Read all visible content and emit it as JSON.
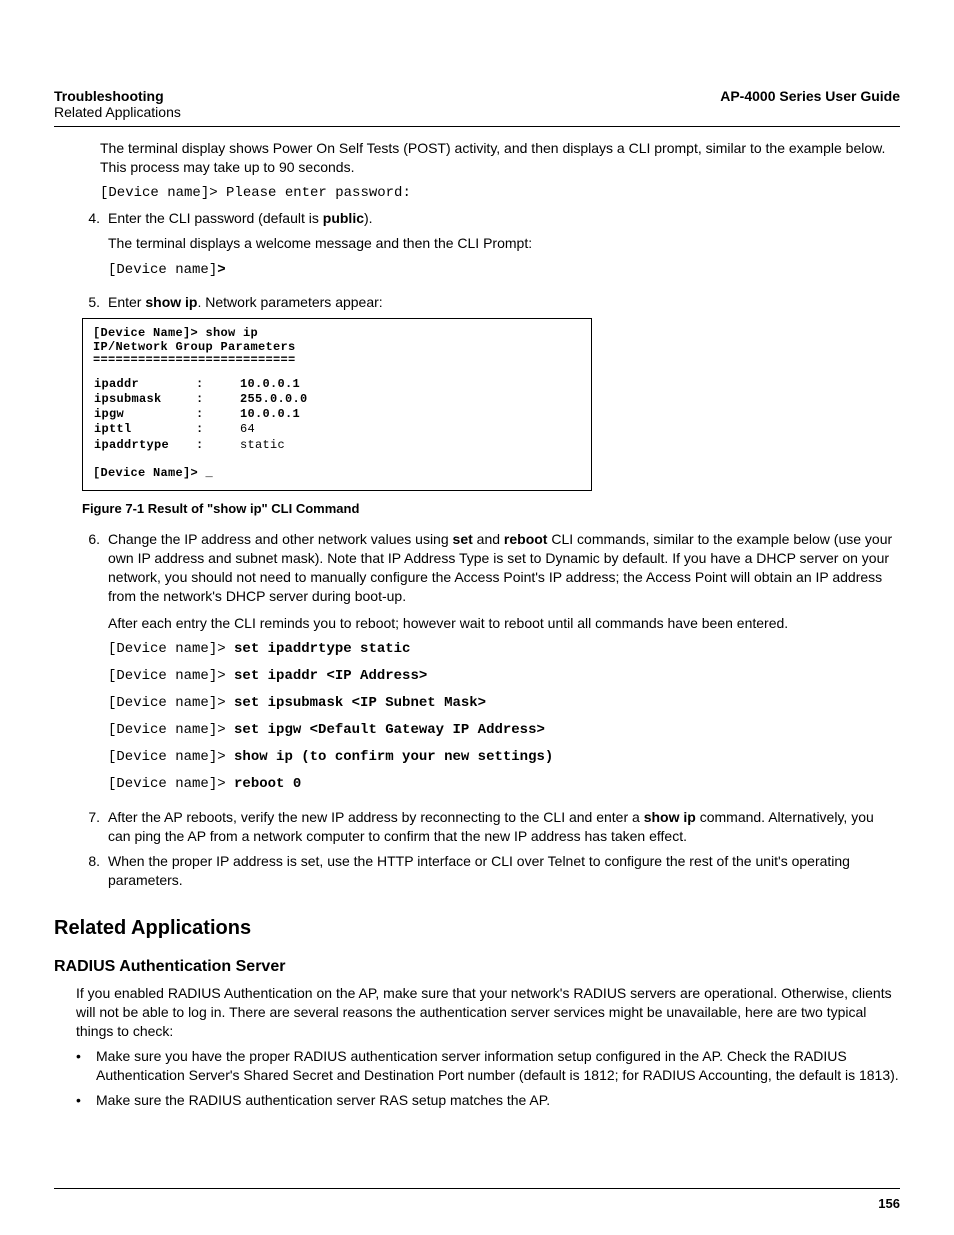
{
  "header": {
    "left1": "Troubleshooting",
    "left2": "Related Applications",
    "right": "AP-4000 Series User Guide"
  },
  "intro": "The terminal display shows Power On Self Tests (POST) activity, and then displays a CLI prompt, similar to the example below. This process may take up to 90 seconds.",
  "mono1": "[Device name]> Please enter password:",
  "step4": {
    "num": "4.",
    "line_a": "Enter the CLI password (default is ",
    "bold_a": "public",
    "line_b": ").",
    "line2": "The terminal displays a welcome message and then the CLI Prompt:",
    "mono_prefix": "[Device name]",
    "mono_suffix": ">"
  },
  "step5": {
    "num": "5.",
    "txt_a": "Enter ",
    "bold": "show ip",
    "txt_b": ". Network parameters appear:"
  },
  "figure": {
    "l1": "[Device Name]> show ip",
    "l2": "IP/Network Group Parameters",
    "dash": "===========================",
    "r1a": "ipaddr",
    "r1b": ":",
    "r1c": "10.0.0.1",
    "r2a": "ipsubmask",
    "r2b": ":",
    "r2c": "255.0.0.0",
    "r3a": "ipgw",
    "r3b": ":",
    "r3c": "10.0.0.1",
    "r4a": "ipttl",
    "r4b": ":",
    "r4c": "64",
    "r5a": "ipaddrtype",
    "r5b": ":",
    "r5c": "static",
    "last": "[Device Name]> _"
  },
  "caption": "Figure 7-1 Result of \"show ip\" CLI Command",
  "step6": {
    "num": "6.",
    "a": "Change the IP address and other network values using ",
    "b1": "set",
    "mid": " and ",
    "b2": "reboot",
    "c": " CLI commands, similar to the example below (use your own IP address and subnet mask). Note that IP Address Type is set to Dynamic by default. If you have a DHCP server on your network, you should not need to manually configure the Access Point's IP address; the Access Point will obtain an IP address from the network's DHCP server during boot-up.",
    "after": "After each entry the CLI reminds you to reboot; however wait to reboot until all commands have been entered.",
    "cmds": {
      "p": "[Device name]> ",
      "c1": "set ipaddrtype static",
      "c2": "set ipaddr <IP Address>",
      "c3": "set ipsubmask <IP Subnet Mask>",
      "c4": "set ipgw <Default Gateway IP Address>",
      "c5": "show ip (to confirm your new settings)",
      "c6": "reboot 0"
    }
  },
  "step7": {
    "num": "7.",
    "a": "After the AP reboots, verify the new IP address by reconnecting to the CLI and enter a ",
    "b": "show ip",
    "c": " command. Alternatively, you can ping the AP from a network computer to confirm that the new IP address has taken effect."
  },
  "step8": {
    "num": "8.",
    "txt": "When the proper IP address is set, use the HTTP interface or CLI over Telnet to configure the rest of the unit's operating parameters."
  },
  "h1": "Related Applications",
  "h2": "RADIUS Authentication Server",
  "radius_p": "If you enabled RADIUS Authentication on the AP, make sure that your network's RADIUS servers are operational. Otherwise, clients will not be able to log in. There are several reasons the authentication server services might be unavailable, here are two typical things to check:",
  "bul1": "Make sure you have the proper RADIUS authentication server information setup configured in the AP. Check the RADIUS Authentication Server's Shared Secret and Destination Port number (default is 1812; for RADIUS Accounting, the default is 1813).",
  "bul2": "Make sure the RADIUS authentication server RAS setup matches the AP.",
  "page_num": "156"
}
